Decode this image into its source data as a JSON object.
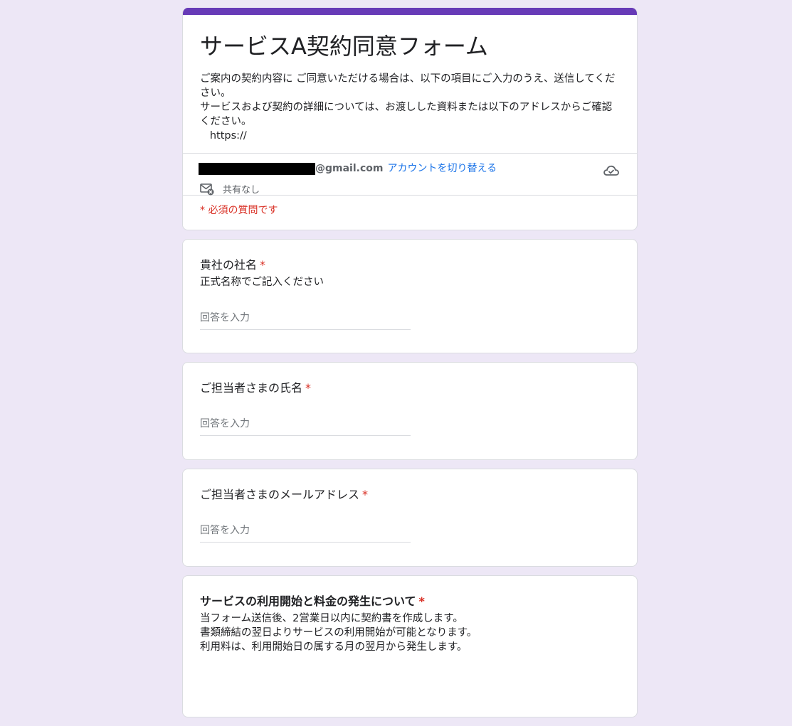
{
  "form": {
    "title": "サービスA契約同意フォーム",
    "description": "ご案内の契約内容に ご同意いただける場合は、以下の項目にご入力のうえ、送信してください。\nサービスおよび契約の詳細については、お渡しした資料または以下のアドレスからご確認ください。\n   https://",
    "accent_color": "#673ab7",
    "background_color": "#ede7f6"
  },
  "account": {
    "email_domain": "@gmail.com",
    "switch_label": "アカウントを切り替える",
    "share_status": "共有なし",
    "save_icon": "cloud-check-icon"
  },
  "required_note": "* 必須の質問です",
  "questions": [
    {
      "title": "貴社の社名",
      "required_mark": "*",
      "description": "正式名称でご記入ください",
      "placeholder": "回答を入力"
    },
    {
      "title": "ご担当者さまの氏名",
      "required_mark": "*",
      "placeholder": "回答を入力"
    },
    {
      "title": "ご担当者さまのメールアドレス",
      "required_mark": "*",
      "placeholder": "回答を入力"
    },
    {
      "title": "サービスの利用開始と料金の発生について",
      "required_mark": "*",
      "description": "当フォーム送信後、2営業日以内に契約書を作成します。\n書類締結の翌日よりサービスの利用開始が可能となります。\n利用料は、利用開始日の属する月の翌月から発生します。"
    }
  ]
}
